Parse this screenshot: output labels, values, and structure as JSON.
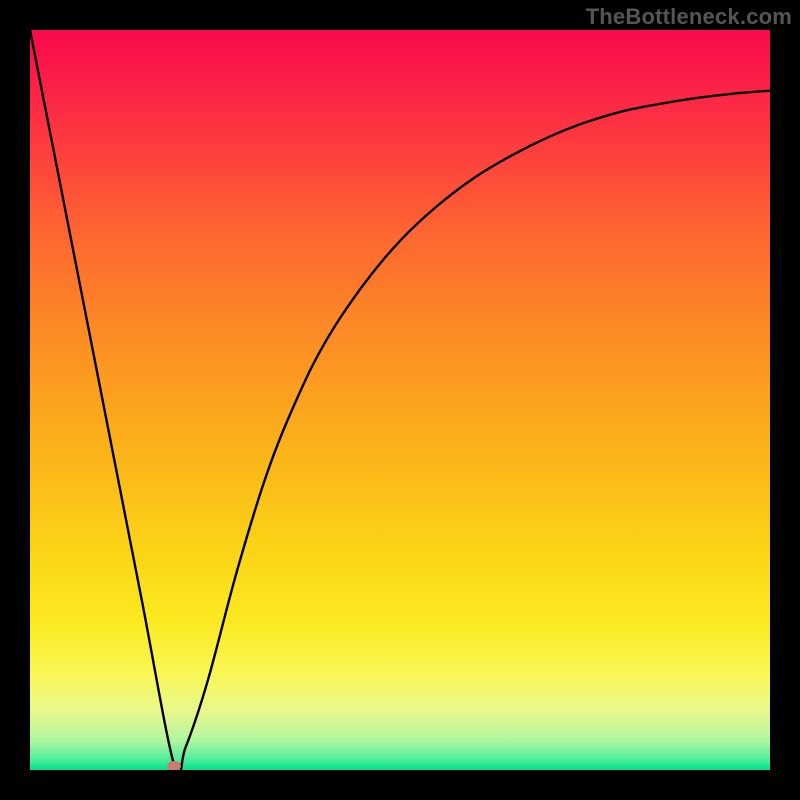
{
  "attribution": "TheBottleneck.com",
  "chart_data": {
    "type": "line",
    "title": "",
    "xlabel": "",
    "ylabel": "",
    "xlim": [
      0,
      1
    ],
    "ylim": [
      0,
      1
    ],
    "x": [
      0.0,
      0.05,
      0.1,
      0.15,
      0.195,
      0.21,
      0.24,
      0.28,
      0.32,
      0.36,
      0.4,
      0.45,
      0.5,
      0.55,
      0.6,
      0.65,
      0.7,
      0.75,
      0.8,
      0.85,
      0.9,
      0.95,
      1.0
    ],
    "values": [
      1.0,
      0.745,
      0.49,
      0.235,
      0.006,
      0.03,
      0.12,
      0.27,
      0.4,
      0.5,
      0.58,
      0.655,
      0.715,
      0.762,
      0.8,
      0.83,
      0.855,
      0.875,
      0.89,
      0.9,
      0.908,
      0.914,
      0.918
    ],
    "marker": {
      "x": 0.195,
      "y": 0.006
    },
    "gradient_stops": [
      {
        "pos": 0.0,
        "color": "#f80a4a"
      },
      {
        "pos": 0.06,
        "color": "#fb1c49"
      },
      {
        "pos": 0.15,
        "color": "#fd3a3f"
      },
      {
        "pos": 0.28,
        "color": "#fd6830"
      },
      {
        "pos": 0.42,
        "color": "#fc8e24"
      },
      {
        "pos": 0.56,
        "color": "#fbb11a"
      },
      {
        "pos": 0.7,
        "color": "#fbd316"
      },
      {
        "pos": 0.8,
        "color": "#fbea20"
      },
      {
        "pos": 0.87,
        "color": "#f9f655"
      },
      {
        "pos": 0.92,
        "color": "#e9f88c"
      },
      {
        "pos": 0.96,
        "color": "#b0f6a0"
      },
      {
        "pos": 0.985,
        "color": "#52ee9d"
      },
      {
        "pos": 1.0,
        "color": "#00e388"
      }
    ]
  }
}
